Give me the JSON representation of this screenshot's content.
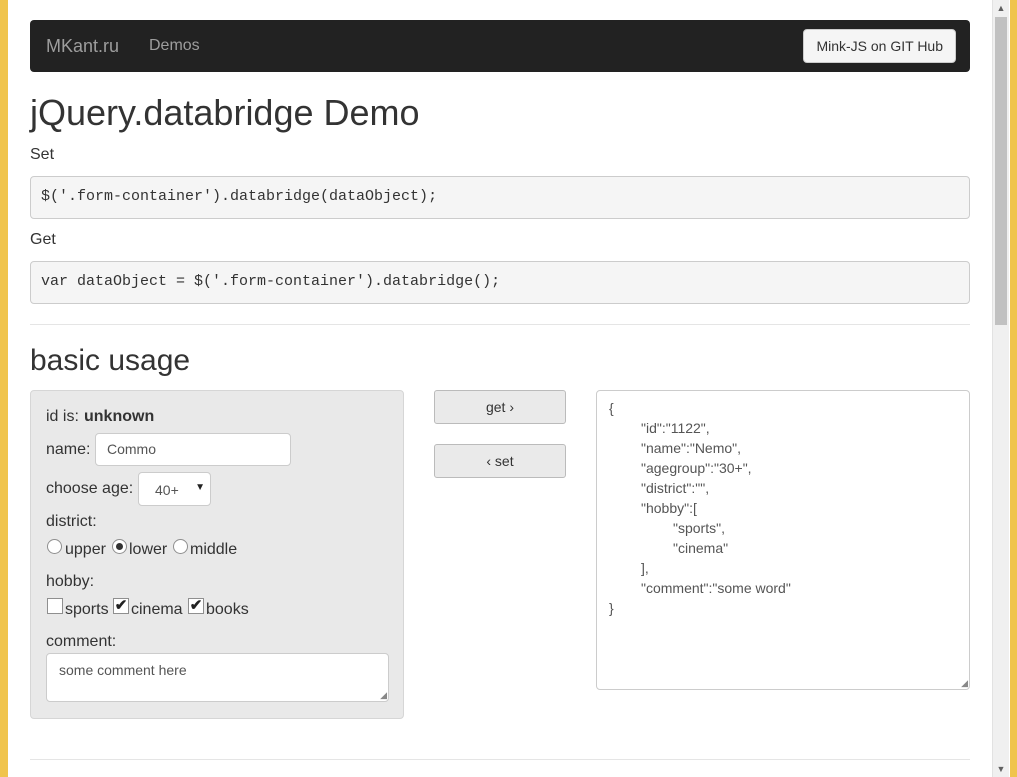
{
  "navbar": {
    "brand": "MKant.ru",
    "demos": "Demos",
    "github_button": "Mink-JS on GIT Hub"
  },
  "page_title": "jQuery.databridge Demo",
  "set": {
    "label": "Set",
    "code": "$('.form-container').databridge(dataObject);"
  },
  "get": {
    "label": "Get",
    "code": "var dataObject = $('.form-container').databridge();"
  },
  "section_title": "basic usage",
  "form": {
    "id_label": "id is:",
    "id_value": "unknown",
    "name_label": "name:",
    "name_value": "Commo",
    "age_label": "choose age:",
    "age_value": "40+",
    "district_label": "district:",
    "district_options": [
      {
        "label": "upper",
        "checked": false
      },
      {
        "label": "lower",
        "checked": true
      },
      {
        "label": "middle",
        "checked": false
      }
    ],
    "hobby_label": "hobby:",
    "hobby_options": [
      {
        "label": "sports",
        "checked": false
      },
      {
        "label": "cinema",
        "checked": true
      },
      {
        "label": "books",
        "checked": true
      }
    ],
    "comment_label": "comment:",
    "comment_value": "some comment here"
  },
  "actions": {
    "get_button": "get ›",
    "set_button": "‹ set"
  },
  "json_output": {
    "lines": [
      "{",
      "\"id\":\"1122\",",
      "\"name\":\"Nemo\",",
      "\"agegroup\":\"30+\",",
      "\"district\":\"\",",
      "\"hobby\":[",
      "\"sports\",",
      "\"cinema\"",
      "],",
      "\"comment\":\"some word\"",
      "}"
    ]
  }
}
